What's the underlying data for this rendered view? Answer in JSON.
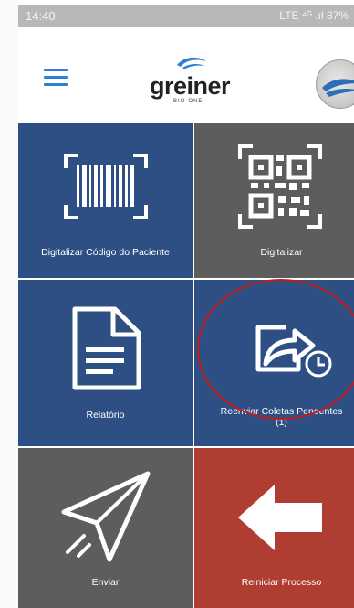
{
  "statusbar": {
    "time": "14:40",
    "indicators": "LTE ⁴ᴳ .ıl 87%"
  },
  "header": {
    "logo_text": "greiner",
    "logo_sub": "BIO-ONE",
    "menu_icon": "hamburger-menu-icon",
    "avatar_icon": "globe-avatar-icon"
  },
  "tiles": [
    {
      "label": "Digitalizar Código do Paciente",
      "icon": "barcode-scan-icon",
      "color": "#2e4f84"
    },
    {
      "label": "Digitalizar",
      "icon": "qr-code-scan-icon",
      "color": "#5d5d5d"
    },
    {
      "label": "Relatório",
      "icon": "document-icon",
      "color": "#2e4f84"
    },
    {
      "label": "Reenviar Coletas Pendentes",
      "label_count": "(1)",
      "icon": "share-clock-icon",
      "color": "#2e4f84"
    },
    {
      "label": "Enviar",
      "icon": "paper-plane-icon",
      "color": "#5d5d5d"
    },
    {
      "label": "Reiniciar Processo",
      "icon": "arrow-left-icon",
      "color": "#b03d31"
    }
  ],
  "annotation": {
    "color": "#c41b1b"
  }
}
